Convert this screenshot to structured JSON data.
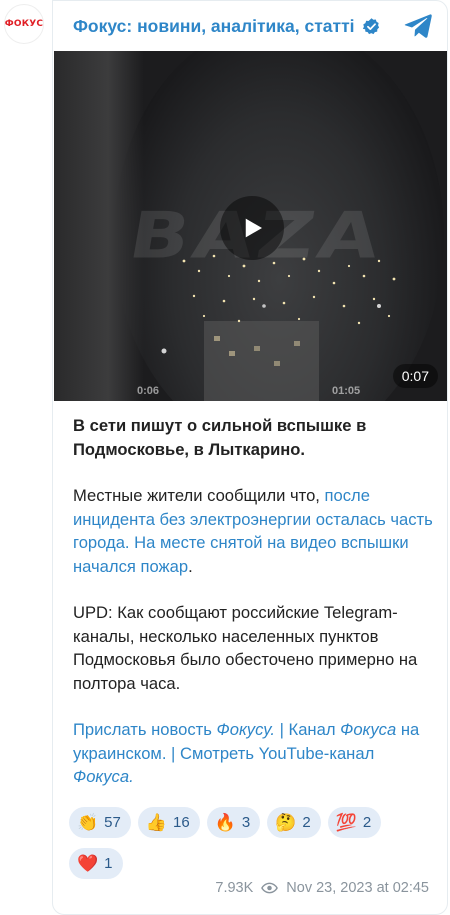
{
  "channel": {
    "avatar_text": "ФОКУС",
    "name": "Фокус: новини, аналітика, статті"
  },
  "video": {
    "watermark": "BAZA",
    "time_left": "0:06",
    "time_right": "01:05",
    "duration": "0:07"
  },
  "post": {
    "headline": "В сети пишут о сильной вспышке в Подмосковье, в Лыткарино.",
    "p2_start": "Местные жители сообщили что, ",
    "p2_link": "после инцидента без электроэнергии осталась часть города. На месте снятой на видео вспышки начался пожар",
    "p2_end": ".",
    "p3": "UPD: Как сообщают российские Telegram-каналы, несколько населенных пунктов Подмосковья было обесточено примерно на полтора часа.",
    "links": {
      "send_news_a": "Прислать новость ",
      "send_news_b": "Фокусу.",
      "sep1": " | ",
      "channel_a": "Канал ",
      "channel_b": "Фокуса",
      "channel_c": " на украинском.",
      "sep2": " | ",
      "youtube_a": "Смотреть YouTube-канал ",
      "youtube_b": "Фокуса."
    }
  },
  "reactions": [
    {
      "emoji": "👏",
      "count": "57"
    },
    {
      "emoji": "👍",
      "count": "16"
    },
    {
      "emoji": "🔥",
      "count": "3"
    },
    {
      "emoji": "🤔",
      "count": "2"
    },
    {
      "emoji": "💯",
      "count": "2"
    },
    {
      "emoji": "❤️",
      "count": "1"
    }
  ],
  "footer": {
    "views": "7.93K",
    "date": "Nov 23, 2023 at 02:45"
  },
  "colors": {
    "accent": "#2e86c8",
    "reaction_bg": "#e3ecf7",
    "meta": "#8a949d"
  }
}
